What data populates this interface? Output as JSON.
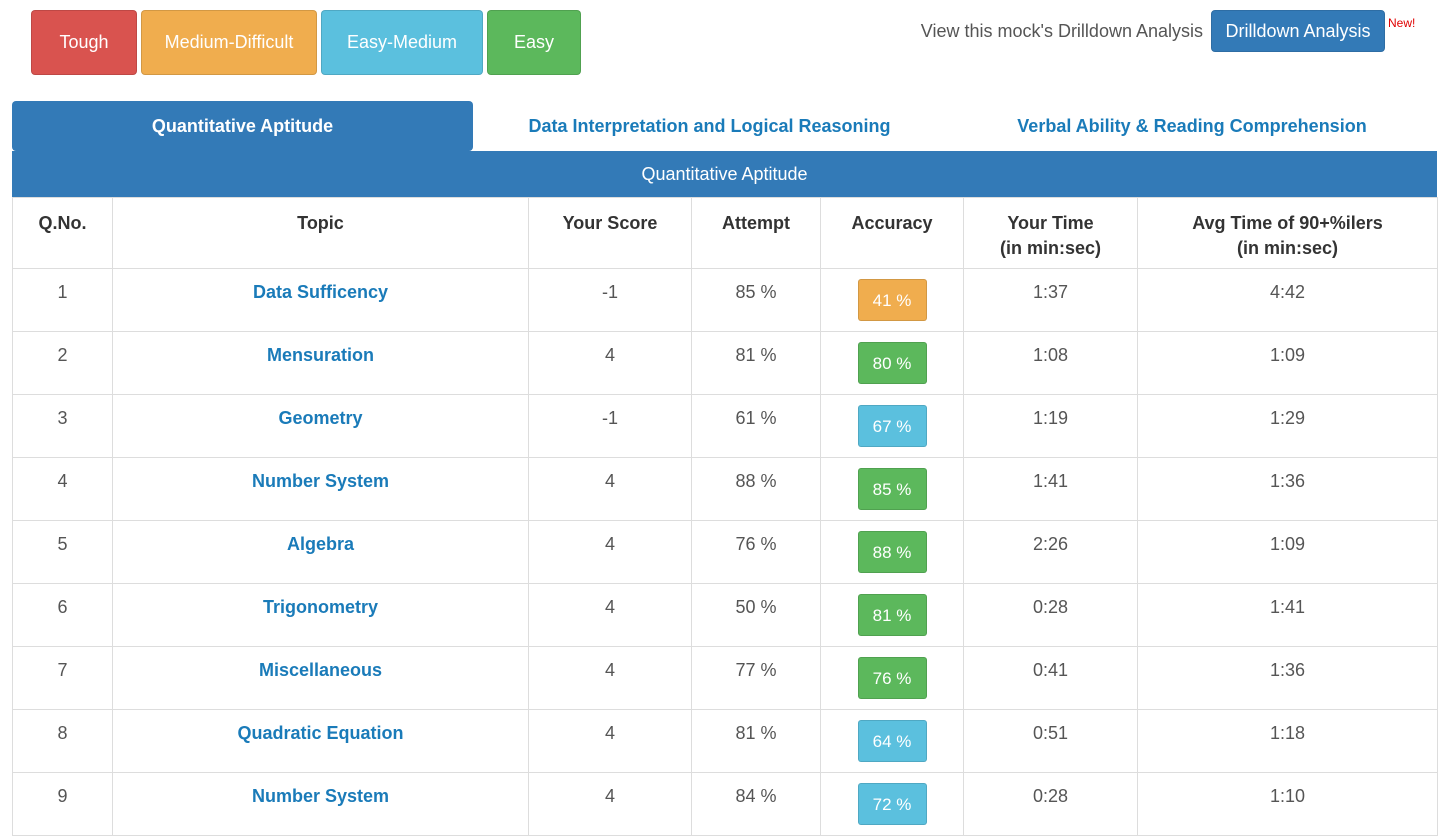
{
  "legend": {
    "tough": "Tough",
    "medium_difficult": "Medium-Difficult",
    "easy_medium": "Easy-Medium",
    "easy": "Easy"
  },
  "drilldown": {
    "label": "View this mock's Drilldown Analysis",
    "button": "Drilldown Analysis",
    "badge": "New!"
  },
  "tabs": [
    {
      "label": "Quantitative Aptitude",
      "active": true
    },
    {
      "label": "Data Interpretation and Logical Reasoning",
      "active": false
    },
    {
      "label": "Verbal Ability & Reading Comprehension",
      "active": false
    }
  ],
  "section_title": "Quantitative Aptitude",
  "columns": {
    "qno": "Q.No.",
    "topic": "Topic",
    "score": "Your Score",
    "attempt": "Attempt",
    "accuracy": "Accuracy",
    "your_time_1": "Your Time",
    "your_time_2": "(in min:sec)",
    "avg_time_1": "Avg Time of 90+%ilers",
    "avg_time_2": "(in min:sec)"
  },
  "rows": [
    {
      "qno": "1",
      "topic": "Data Sufficency",
      "score": "-1",
      "attempt": "85 %",
      "accuracy": "41 %",
      "level": "orange",
      "your_time": "1:37",
      "avg_time": "4:42"
    },
    {
      "qno": "2",
      "topic": "Mensuration",
      "score": "4",
      "attempt": "81 %",
      "accuracy": "80 %",
      "level": "green",
      "your_time": "1:08",
      "avg_time": "1:09"
    },
    {
      "qno": "3",
      "topic": "Geometry",
      "score": "-1",
      "attempt": "61 %",
      "accuracy": "67 %",
      "level": "blue",
      "your_time": "1:19",
      "avg_time": "1:29"
    },
    {
      "qno": "4",
      "topic": "Number System",
      "score": "4",
      "attempt": "88 %",
      "accuracy": "85 %",
      "level": "green",
      "your_time": "1:41",
      "avg_time": "1:36"
    },
    {
      "qno": "5",
      "topic": "Algebra",
      "score": "4",
      "attempt": "76 %",
      "accuracy": "88 %",
      "level": "green",
      "your_time": "2:26",
      "avg_time": "1:09"
    },
    {
      "qno": "6",
      "topic": "Trigonometry",
      "score": "4",
      "attempt": "50 %",
      "accuracy": "81 %",
      "level": "green",
      "your_time": "0:28",
      "avg_time": "1:41"
    },
    {
      "qno": "7",
      "topic": "Miscellaneous",
      "score": "4",
      "attempt": "77 %",
      "accuracy": "76 %",
      "level": "green",
      "your_time": "0:41",
      "avg_time": "1:36"
    },
    {
      "qno": "8",
      "topic": "Quadratic Equation",
      "score": "4",
      "attempt": "81 %",
      "accuracy": "64 %",
      "level": "blue",
      "your_time": "0:51",
      "avg_time": "1:18"
    },
    {
      "qno": "9",
      "topic": "Number System",
      "score": "4",
      "attempt": "84 %",
      "accuracy": "72 %",
      "level": "blue",
      "your_time": "0:28",
      "avg_time": "1:10"
    }
  ]
}
